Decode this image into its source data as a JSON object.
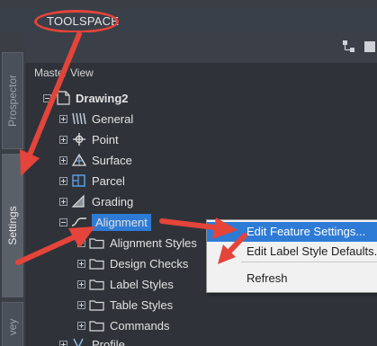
{
  "app": {
    "title": "TOOLSPACE"
  },
  "tabs": [
    {
      "label": "Prospector",
      "active": false
    },
    {
      "label": "Settings",
      "active": true
    },
    {
      "label": "vey",
      "active": false
    }
  ],
  "panel": {
    "header": "Master View"
  },
  "tree": {
    "root": "Drawing2",
    "items": [
      {
        "label": "General",
        "icon": "general-icon"
      },
      {
        "label": "Point",
        "icon": "point-icon"
      },
      {
        "label": "Surface",
        "icon": "surface-icon"
      },
      {
        "label": "Parcel",
        "icon": "parcel-icon"
      },
      {
        "label": "Grading",
        "icon": "grading-icon"
      },
      {
        "label": "Alignment",
        "icon": "alignment-icon",
        "selected": true
      }
    ],
    "children": [
      {
        "label": "Alignment Styles"
      },
      {
        "label": "Design Checks"
      },
      {
        "label": "Label Styles"
      },
      {
        "label": "Table Styles"
      },
      {
        "label": "Commands"
      }
    ],
    "next": {
      "label": "Profile",
      "icon": "profile-icon"
    }
  },
  "context_menu": {
    "items": [
      {
        "label": "Edit Feature Settings...",
        "highlighted": true
      },
      {
        "label": "Edit Label Style Defaults..."
      },
      {
        "label": "Refresh"
      }
    ]
  },
  "colors": {
    "accent": "#2e7bd6",
    "annotation": "#e4443a",
    "panel_bg": "#2f3339",
    "menu_bg": "#f1f1f1"
  }
}
